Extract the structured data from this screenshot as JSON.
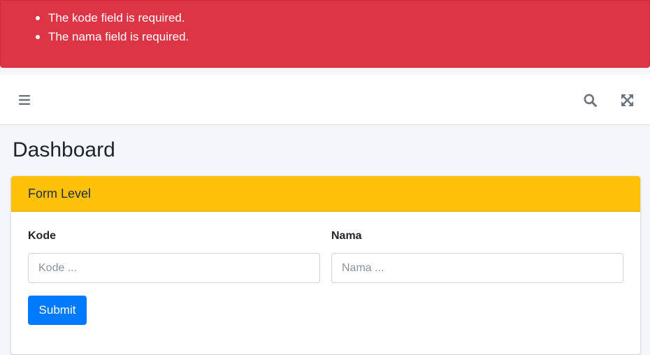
{
  "alert": {
    "errors": [
      "The kode field is required.",
      "The nama field is required."
    ],
    "color": "#dc3545"
  },
  "navbar": {
    "menu_icon": "hamburger-menu-icon",
    "search_icon": "search-icon",
    "fullscreen_icon": "expand-arrows-icon"
  },
  "page": {
    "title": "Dashboard"
  },
  "card": {
    "header": "Form Level",
    "header_color": "#ffc107",
    "fields": {
      "kode": {
        "label": "Kode",
        "placeholder": "Kode ...",
        "value": ""
      },
      "nama": {
        "label": "Nama",
        "placeholder": "Nama ...",
        "value": ""
      }
    },
    "submit_label": "Submit",
    "submit_color": "#007bff"
  }
}
